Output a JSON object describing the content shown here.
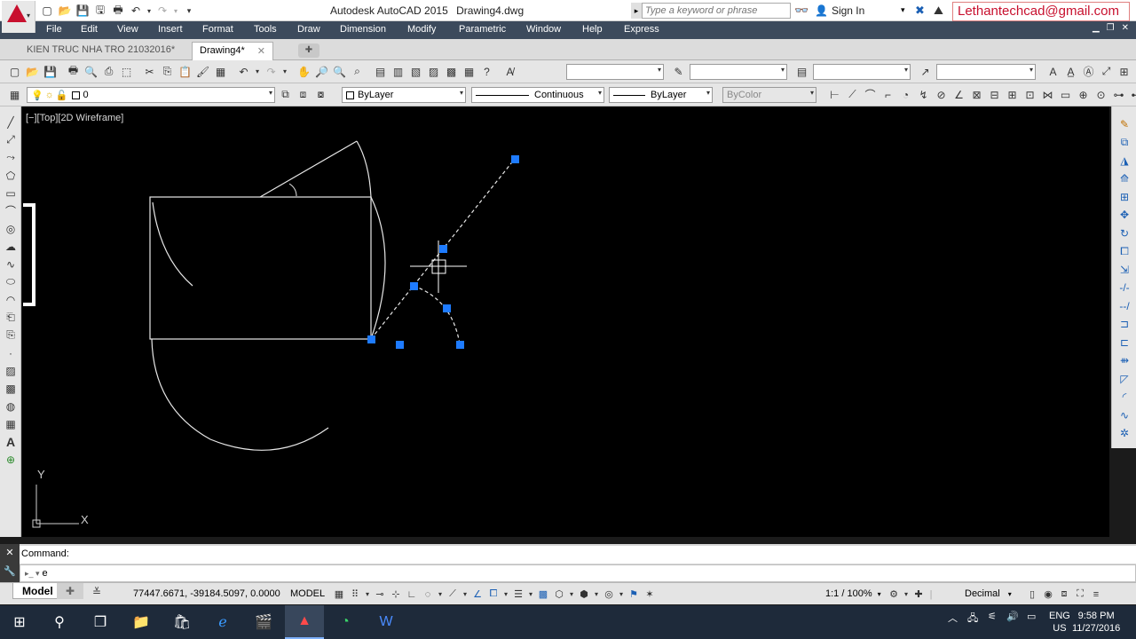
{
  "app": {
    "title": "Autodesk AutoCAD 2015",
    "filename": "Drawing4.dwg",
    "search_placeholder": "Type a keyword or phrase",
    "signin_label": "Sign In",
    "email_banner": "Lethantechcad@gmail.com"
  },
  "menu": {
    "items": [
      "File",
      "Edit",
      "View",
      "Insert",
      "Format",
      "Tools",
      "Draw",
      "Dimension",
      "Modify",
      "Parametric",
      "Window",
      "Help",
      "Express"
    ]
  },
  "doc_tabs": {
    "tabs": [
      {
        "label": "KIEN TRUC NHA TRO 21032016*",
        "active": false
      },
      {
        "label": "Drawing4*",
        "active": true
      }
    ],
    "close_glyph": "✕",
    "add_glyph": "✚"
  },
  "properties": {
    "layer": "0",
    "color": "ByLayer",
    "linetype": "Continuous",
    "lineweight": "ByLayer",
    "plotstyle": "ByColor"
  },
  "viewport": {
    "label": "[−][Top][2D Wireframe]",
    "ucs_x": "X",
    "ucs_y": "Y"
  },
  "command": {
    "history": "Command:",
    "input_value": "e"
  },
  "status": {
    "layout_tab": "Model",
    "coordinates": "77447.6671, -39184.5097, 0.0000",
    "model_space": "MODEL",
    "annotation_scale": "1:1 / 100%",
    "units": "Decimal"
  },
  "taskbar": {
    "language_top": "ENG",
    "language_bottom": "US",
    "time": "9:58 PM",
    "date": "11/27/2016"
  },
  "colors": {
    "menubar": "#3c4a5c",
    "viewport_bg": "#000000",
    "grip": "#1e7bff",
    "geometry": "#e8e8e8"
  }
}
